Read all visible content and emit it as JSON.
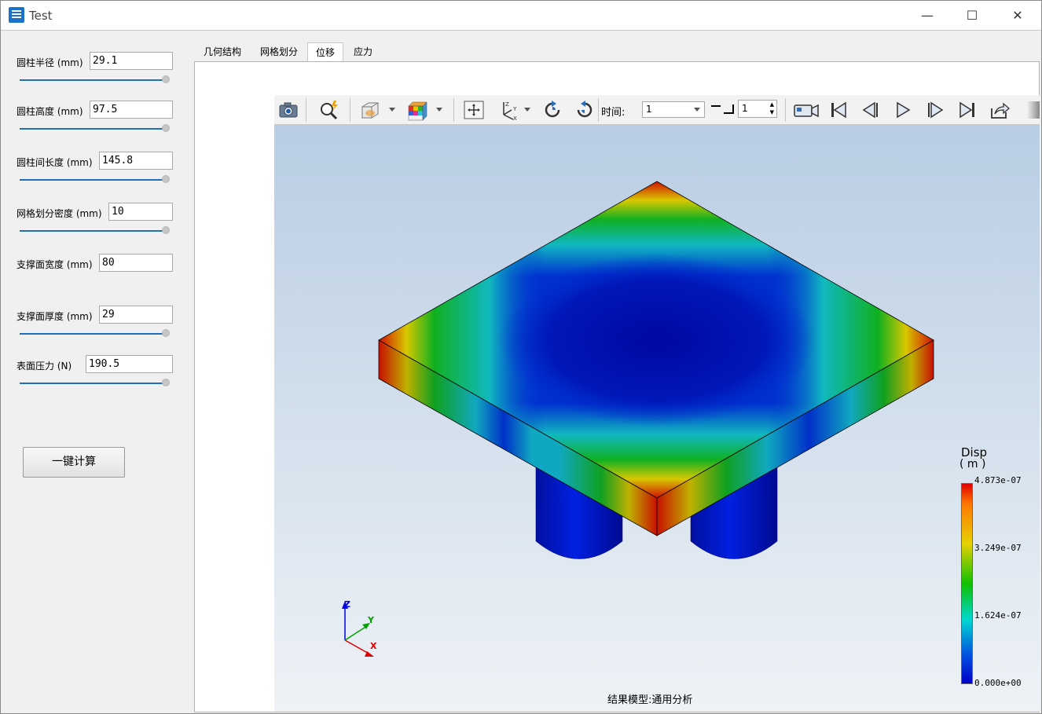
{
  "window": {
    "title": "Test",
    "minimize": "—",
    "maximize": "☐",
    "close": "✕"
  },
  "params": [
    {
      "label": "圆柱半径 (mm)",
      "value": "29.1",
      "slider": 1.0
    },
    {
      "label": "圆柱高度 (mm)",
      "value": "97.5",
      "slider": 1.0
    },
    {
      "label": "圆柱间长度 (mm)",
      "value": "145.8",
      "slider": 1.0
    },
    {
      "label": "网格划分密度 (mm)",
      "value": "10",
      "slider": 1.0
    },
    {
      "label": "支撑面宽度 (mm)",
      "value": "80",
      "slider": 1.0
    },
    {
      "label": "支撑面厚度 (mm)",
      "value": "29",
      "slider": 1.0
    },
    {
      "label": "表面压力 (N)",
      "value": "190.5",
      "slider": 1.0
    }
  ],
  "calc_button": "一键计算",
  "tabs": [
    {
      "label": "几何结构",
      "active": false
    },
    {
      "label": "网格划分",
      "active": false
    },
    {
      "label": "位移",
      "active": true
    },
    {
      "label": "应力",
      "active": false
    }
  ],
  "toolbar": {
    "icons": [
      "camera-icon",
      "zoom-icon",
      "view-cube-icon",
      "color-cube-icon",
      "fit-view-icon",
      "axes-icon",
      "rotate-cw-icon",
      "rotate-ccw-icon",
      "record-icon",
      "first-frame-icon",
      "prev-frame-icon",
      "play-icon",
      "next-frame-icon",
      "last-frame-icon",
      "export-icon"
    ],
    "time_label": "时间:",
    "time_value": "1",
    "step_value": "1"
  },
  "viewport": {
    "legend": {
      "title": "Disp",
      "unit": "( m )",
      "labels": [
        "4.873e-07",
        "3.249e-07",
        "1.624e-07",
        "0.000e+00"
      ]
    },
    "axes": {
      "z": "Z",
      "y": "Y",
      "x": "X"
    },
    "caption": "结果模型:通用分析"
  },
  "colors": {
    "accent": "#1f6fbf",
    "max": "#e00000",
    "min": "#0000c8"
  }
}
